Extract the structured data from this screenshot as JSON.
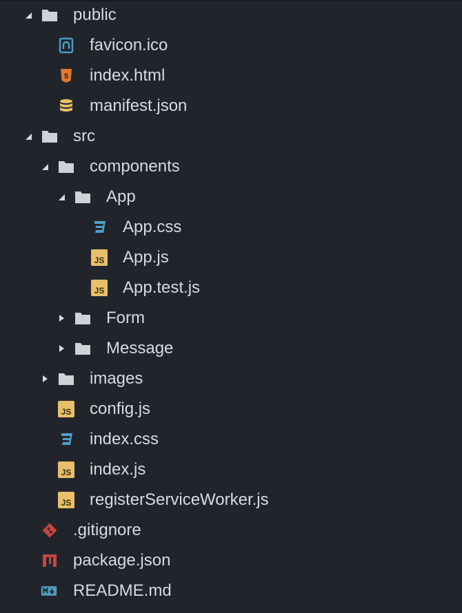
{
  "theme": {
    "background": "#21252b",
    "text": "#d7dae0",
    "folder": "#cfd2d6",
    "twisty": "#d7dae0",
    "js": "#e8bf6a",
    "css": "#4fa0c8",
    "html": "#e37933",
    "json": "#e8bf6a",
    "favicon": "#4a9bc7",
    "git": "#c5463f",
    "npm": "#c5463f",
    "markdown": "#519aba"
  },
  "tree": [
    {
      "id": "public",
      "label": "public",
      "kind": "folder",
      "depth": 0,
      "expanded": true
    },
    {
      "id": "favicon",
      "label": "favicon.ico",
      "kind": "favicon",
      "depth": 1
    },
    {
      "id": "index-html",
      "label": "index.html",
      "kind": "html",
      "depth": 1
    },
    {
      "id": "manifest",
      "label": "manifest.json",
      "kind": "json",
      "depth": 1
    },
    {
      "id": "src",
      "label": "src",
      "kind": "folder",
      "depth": 0,
      "expanded": true
    },
    {
      "id": "components",
      "label": "components",
      "kind": "folder",
      "depth": 1,
      "expanded": true
    },
    {
      "id": "app-folder",
      "label": "App",
      "kind": "folder",
      "depth": 2,
      "expanded": true
    },
    {
      "id": "app-css",
      "label": "App.css",
      "kind": "css",
      "depth": 3
    },
    {
      "id": "app-js",
      "label": "App.js",
      "kind": "js",
      "depth": 3
    },
    {
      "id": "app-test-js",
      "label": "App.test.js",
      "kind": "js",
      "depth": 3
    },
    {
      "id": "form",
      "label": "Form",
      "kind": "folder",
      "depth": 2,
      "expanded": false
    },
    {
      "id": "message",
      "label": "Message",
      "kind": "folder",
      "depth": 2,
      "expanded": false
    },
    {
      "id": "images",
      "label": "images",
      "kind": "folder",
      "depth": 1,
      "expanded": false
    },
    {
      "id": "config-js",
      "label": "config.js",
      "kind": "js",
      "depth": 1
    },
    {
      "id": "index-css",
      "label": "index.css",
      "kind": "css",
      "depth": 1
    },
    {
      "id": "index-js",
      "label": "index.js",
      "kind": "js",
      "depth": 1
    },
    {
      "id": "register-sw",
      "label": "registerServiceWorker.js",
      "kind": "js",
      "depth": 1
    },
    {
      "id": "gitignore",
      "label": ".gitignore",
      "kind": "git",
      "depth": 0
    },
    {
      "id": "package-json",
      "label": "package.json",
      "kind": "npm",
      "depth": 0
    },
    {
      "id": "readme",
      "label": "README.md",
      "kind": "markdown",
      "depth": 0
    }
  ]
}
